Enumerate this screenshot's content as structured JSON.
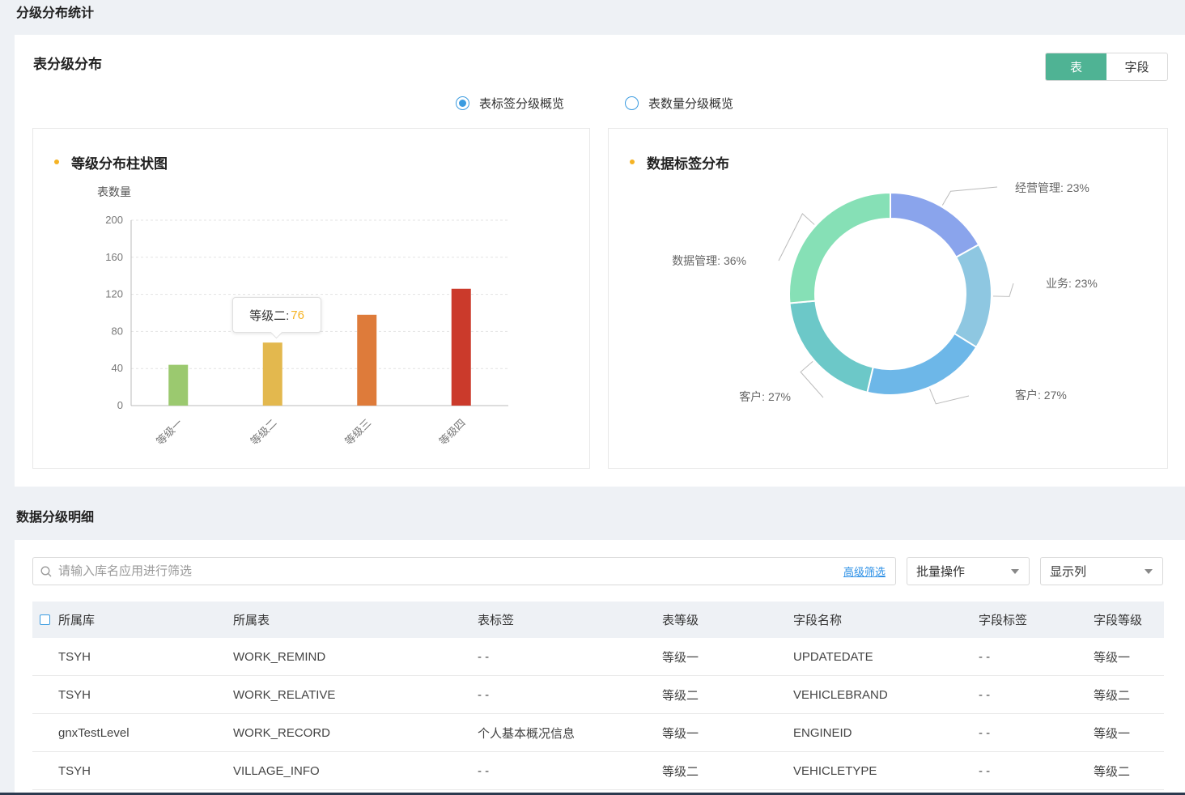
{
  "page": {
    "section_distribution_title": "分级分布统计",
    "section_detail_title": "数据分级明细"
  },
  "table_dist": {
    "title": "表分级分布",
    "toggle": [
      {
        "label": "表",
        "active": true
      },
      {
        "label": "字段",
        "active": false
      }
    ],
    "radios": [
      {
        "label": "表标签分级概览",
        "checked": true
      },
      {
        "label": "表数量分级概览",
        "checked": false
      }
    ]
  },
  "bar_card": {
    "title": "等级分布柱状图",
    "tooltip": {
      "label": "等级二:",
      "value": "76"
    }
  },
  "pie_card": {
    "title": "数据标签分布"
  },
  "colors": {
    "accent": "#4fb394",
    "bar": [
      "#9bc96f",
      "#e3b84e",
      "#de7b3a",
      "#cb3a2b"
    ],
    "pie": [
      "#8aa4ec",
      "#8ec7e1",
      "#6db7e8",
      "#6cc8c8",
      "#86e0b6"
    ]
  },
  "chart_data": [
    {
      "type": "bar",
      "title": "",
      "ylabel": "表数量",
      "xlabel": "",
      "categories": [
        "等级一",
        "等级二",
        "等级三",
        "等级四"
      ],
      "values": [
        44,
        68,
        98,
        126
      ],
      "ylim": [
        0,
        200
      ],
      "yticks": [
        0,
        40,
        80,
        120,
        160,
        200
      ],
      "grid": true
    },
    {
      "type": "pie",
      "donut": true,
      "slices": [
        {
          "label": "经营管理",
          "value": 23,
          "text": "经营管理: 23%"
        },
        {
          "label": "业务",
          "value": 23,
          "text": "业务: 23%"
        },
        {
          "label": "客户",
          "value": 27,
          "text": "客户: 27%"
        },
        {
          "label": "客户",
          "value": 27,
          "text": "客户: 27%"
        },
        {
          "label": "数据管理",
          "value": 36,
          "text": "数据管理: 36%"
        }
      ]
    }
  ],
  "filters": {
    "search_placeholder": "请输入库名应用进行筛选",
    "advanced_link": "高级筛选",
    "batch_label": "批量操作",
    "columns_label": "显示列"
  },
  "table": {
    "headers": [
      "所属库",
      "所属表",
      "表标签",
      "表等级",
      "字段名称",
      "字段标签",
      "字段等级"
    ],
    "rows": [
      [
        "TSYH",
        "WORK_REMIND",
        "- -",
        "等级一",
        "UPDATEDATE",
        "- -",
        "等级一"
      ],
      [
        "TSYH",
        "WORK_RELATIVE",
        "- -",
        "等级二",
        "VEHICLEBRAND",
        "- -",
        "等级二"
      ],
      [
        "gnxTestLevel",
        "WORK_RECORD",
        "个人基本概况信息",
        "等级一",
        "ENGINEID",
        "- -",
        "等级一"
      ],
      [
        "TSYH",
        "VILLAGE_INFO",
        "- -",
        "等级二",
        "VEHICLETYPE",
        "- -",
        "等级二"
      ]
    ]
  }
}
